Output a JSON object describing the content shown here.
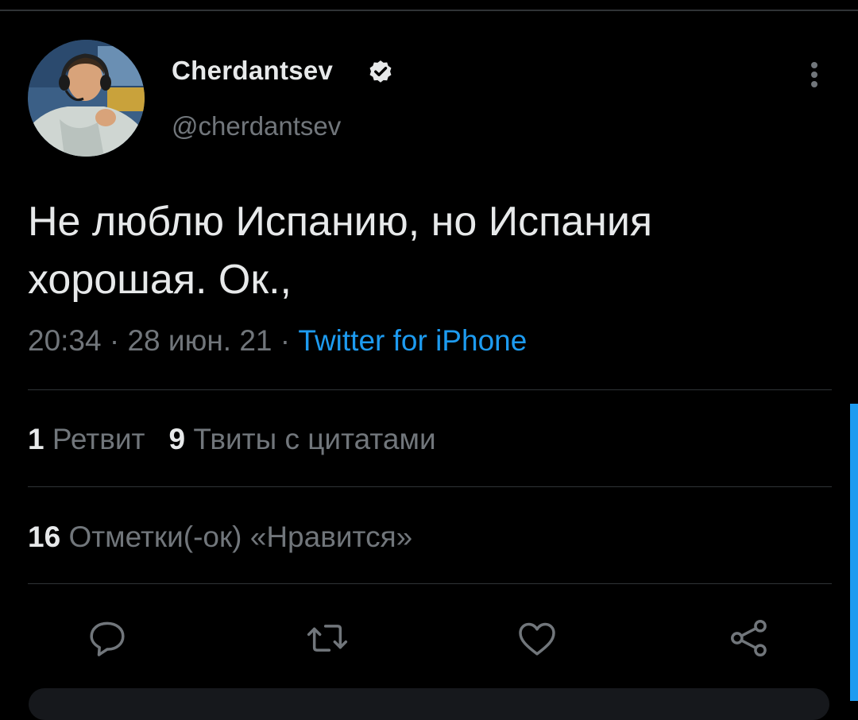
{
  "author": {
    "display_name": "Cherdantsev",
    "handle": "@cherdantsev",
    "verified": true
  },
  "tweet": {
    "text_line1": "Не люблю Испанию, но Испания",
    "text_line2": "хорошая. Ок.,"
  },
  "meta": {
    "time": "20:34",
    "date": "28 июн. 21",
    "separator": "·",
    "source": "Twitter for iPhone"
  },
  "stats": {
    "retweets_count": "1",
    "retweets_label": "Ретвит",
    "quotes_count": "9",
    "quotes_label": "Твиты с цитатами",
    "likes_count": "16",
    "likes_label": "Отметки(-ок) «Нравится»"
  },
  "icons": {
    "reply": "reply-icon",
    "retweet": "retweet-icon",
    "like": "heart-icon",
    "share": "share-icon",
    "more": "more-vertical-icon",
    "verified": "verified-badge-icon"
  },
  "colors": {
    "background": "#000000",
    "primary_text": "#e7e9ea",
    "secondary_text": "#71767b",
    "accent": "#1d9bf0",
    "divider": "#2f3336"
  }
}
